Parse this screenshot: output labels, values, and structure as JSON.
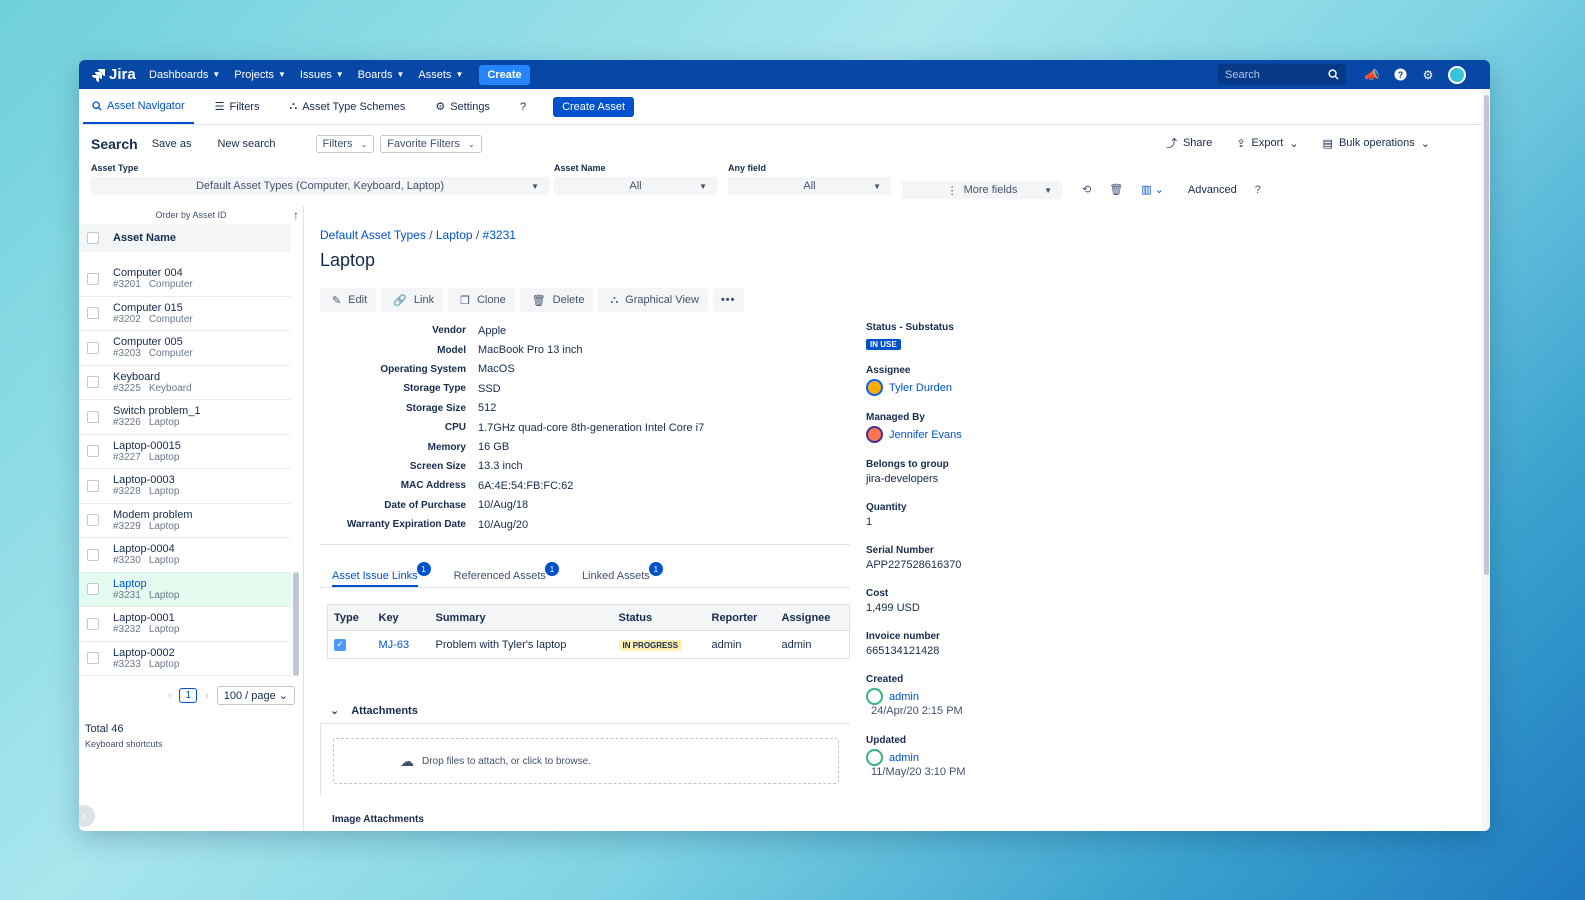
{
  "topnav": {
    "logo": "Jira",
    "items": [
      "Dashboards",
      "Projects",
      "Issues",
      "Boards",
      "Assets"
    ],
    "create_label": "Create",
    "search_placeholder": "Search"
  },
  "subnav": {
    "asset_navigator": "Asset Navigator",
    "filters": "Filters",
    "asset_type_schemes": "Asset Type Schemes",
    "settings": "Settings",
    "help": "?",
    "create_asset": "Create Asset"
  },
  "search": {
    "title": "Search",
    "save_as": "Save as",
    "new_search": "New search",
    "filters_dd": "Filters",
    "favorite_dd": "Favorite Filters",
    "share": "Share",
    "export": "Export",
    "bulk": "Bulk operations",
    "asset_type_label": "Asset Type",
    "asset_type_value": "Default Asset Types (Computer, Keyboard, Laptop)",
    "asset_name_label": "Asset Name",
    "asset_name_value": "All",
    "any_field_label": "Any field",
    "any_field_value": "All",
    "more_fields": "More fields",
    "advanced": "Advanced",
    "help": "?"
  },
  "list": {
    "order_by": "Order by Asset ID",
    "header": "Asset Name",
    "items": [
      {
        "name": "Computer 004",
        "id": "#3201",
        "type": "Computer"
      },
      {
        "name": "Computer 015",
        "id": "#3202",
        "type": "Computer"
      },
      {
        "name": "Computer 005",
        "id": "#3203",
        "type": "Computer"
      },
      {
        "name": "Keyboard",
        "id": "#3225",
        "type": "Keyboard"
      },
      {
        "name": "Switch problem_1",
        "id": "#3226",
        "type": "Laptop"
      },
      {
        "name": "Laptop-00015",
        "id": "#3227",
        "type": "Laptop"
      },
      {
        "name": "Laptop-0003",
        "id": "#3228",
        "type": "Laptop"
      },
      {
        "name": "Modem problem",
        "id": "#3229",
        "type": "Laptop"
      },
      {
        "name": "Laptop-0004",
        "id": "#3230",
        "type": "Laptop"
      },
      {
        "name": "Laptop",
        "id": "#3231",
        "type": "Laptop"
      },
      {
        "name": "Laptop-0001",
        "id": "#3232",
        "type": "Laptop"
      },
      {
        "name": "Laptop-0002",
        "id": "#3233",
        "type": "Laptop"
      }
    ],
    "page": "1",
    "per_page": "100 / page",
    "total": "Total 46",
    "shortcuts": "Keyboard shortcuts"
  },
  "detail": {
    "breadcrumb": [
      "Default Asset Types",
      "Laptop",
      "#3231"
    ],
    "title": "Laptop",
    "actions": [
      "Edit",
      "Link",
      "Clone",
      "Delete",
      "Graphical View"
    ],
    "attributes": [
      {
        "key": "Vendor",
        "value": "Apple"
      },
      {
        "key": "Model",
        "value": "MacBook Pro 13 inch"
      },
      {
        "key": "Operating System",
        "value": "MacOS"
      },
      {
        "key": "Storage Type",
        "value": "SSD"
      },
      {
        "key": "Storage Size",
        "value": "512"
      },
      {
        "key": "CPU",
        "value": "1.7GHz quad-core 8th-generation Intel Core i7"
      },
      {
        "key": "Memory",
        "value": "16 GB"
      },
      {
        "key": "Screen Size",
        "value": "13.3 inch"
      },
      {
        "key": "MAC Address",
        "value": "6A:4E:54:FB:FC:62"
      },
      {
        "key": "Date of Purchase",
        "value": "10/Aug/18"
      },
      {
        "key": "Warranty Expiration Date",
        "value": "10/Aug/20"
      }
    ],
    "tabs": [
      {
        "label": "Asset Issue Links",
        "badge": "1"
      },
      {
        "label": "Referenced Assets",
        "badge": "1"
      },
      {
        "label": "Linked Assets",
        "badge": "1"
      }
    ],
    "issue_table": {
      "headers": [
        "Type",
        "Key",
        "Summary",
        "Status",
        "Reporter",
        "Assignee"
      ],
      "row": {
        "key": "MJ-63",
        "summary": "Problem with Tyler's laptop",
        "status": "IN PROGRESS",
        "reporter": "admin",
        "assignee": "admin"
      }
    },
    "attachments": "Attachments",
    "dropzone": "Drop files to attach, or click to browse.",
    "image_attachments": "Image Attachments"
  },
  "fields": {
    "status_label": "Status - Substatus",
    "status_value": "IN USE",
    "assignee_label": "Assignee",
    "assignee_value": "Tyler Durden",
    "managed_label": "Managed By",
    "managed_value": "Jennifer Evans",
    "group_label": "Belongs to group",
    "group_value": "jira-developers",
    "quantity_label": "Quantity",
    "quantity_value": "1",
    "serial_label": "Serial Number",
    "serial_value": "APP227528616370",
    "cost_label": "Cost",
    "cost_value": "1,499 USD",
    "invoice_label": "Invoice number",
    "invoice_value": "665134121428",
    "created_label": "Created",
    "created_user": "admin",
    "created_date": "24/Apr/20 2:15 PM",
    "updated_label": "Updated",
    "updated_user": "admin",
    "updated_date": "11/May/20 3:10 PM"
  },
  "colors": {
    "nav": "#0747a6",
    "primary": "#0052cc",
    "selected_row": "#e3fcef"
  }
}
